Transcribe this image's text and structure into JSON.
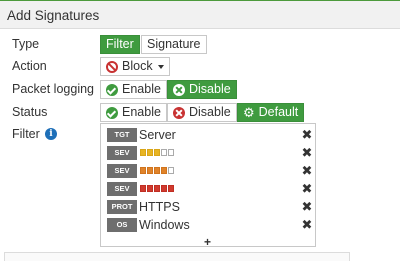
{
  "header": {
    "title": "Add Signatures"
  },
  "colors": {
    "accent": "#3f9b3f",
    "danger": "#c83232",
    "info": "#1e6fb8",
    "tag": "#6e6e6e"
  },
  "type": {
    "label": "Type",
    "options": [
      "Filter",
      "Signature"
    ],
    "selected": "Filter"
  },
  "action": {
    "label": "Action",
    "value": "Block",
    "icon": "block-icon"
  },
  "packet_logging": {
    "label": "Packet logging",
    "enable": "Enable",
    "disable": "Disable",
    "selected": "Disable"
  },
  "status": {
    "label": "Status",
    "enable": "Enable",
    "disable": "Disable",
    "default": "Default",
    "selected": "Default"
  },
  "filter": {
    "label": "Filter",
    "items": [
      {
        "tag": "TGT",
        "text": "Server"
      },
      {
        "tag": "SEV",
        "level": 3,
        "of": 5,
        "color": "yellow"
      },
      {
        "tag": "SEV",
        "level": 4,
        "of": 5,
        "color": "orange"
      },
      {
        "tag": "SEV",
        "level": 5,
        "of": 5,
        "color": "red"
      },
      {
        "tag": "PROT",
        "text": "HTTPS"
      },
      {
        "tag": "OS",
        "text": "Windows"
      }
    ],
    "add_label": "+"
  }
}
